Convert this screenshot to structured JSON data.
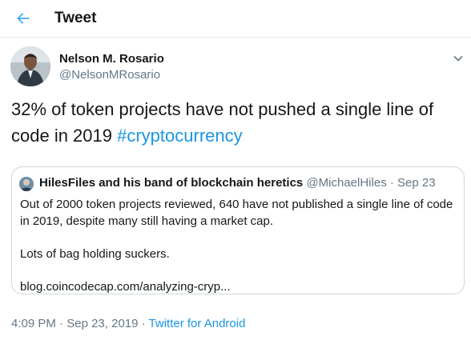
{
  "header": {
    "title": "Tweet",
    "back_icon": "arrow-left-icon",
    "accent": "#1da1f2"
  },
  "author": {
    "name": "Nelson M. Rosario",
    "handle": "@NelsonMRosario"
  },
  "tweet": {
    "text": "32% of token projects have not pushed a single line of code in 2019 ",
    "hashtag": "#cryptocurrency"
  },
  "quoted": {
    "name": "HilesFiles and his band of blockchain heretics",
    "handle": "@MichaelHiles",
    "separator": "·",
    "date": "Sep 23",
    "paragraphs": [
      "Out of 2000 token projects reviewed, 640 have not published a single line of code in 2019, despite many still having a market cap.",
      "Lots of bag holding suckers.",
      "blog.coincodecap.com/analyzing-cryp..."
    ]
  },
  "meta": {
    "time": "4:09 PM",
    "separator1": "·",
    "date": "Sep 23, 2019",
    "separator2": "·",
    "source": "Twitter for Android"
  },
  "colors": {
    "link": "#1b95e0",
    "secondary_text": "#657786",
    "border": "#ccd6dd"
  }
}
